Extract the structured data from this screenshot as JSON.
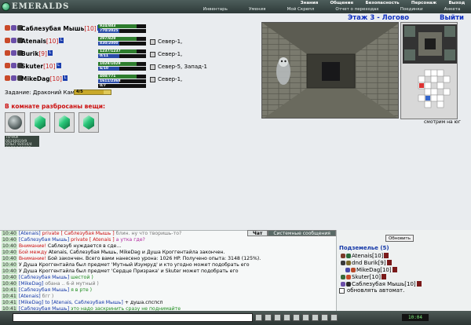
{
  "header": {
    "logo_text": "EMERALDS",
    "menu_top": [
      "Знания",
      "Общение",
      "Безопасность",
      "Персонаж",
      "Выход"
    ],
    "menu_bottom": [
      "Инвентарь",
      "Умения",
      "Мой Скрепл",
      "Отчет о переходах",
      "Поединки",
      "Анкета"
    ]
  },
  "players": [
    {
      "name": "Саблезубая Мышь",
      "level": "[10]",
      "badge": "L",
      "hp": "924/883",
      "mp": "770/2025",
      "loc": ""
    },
    {
      "name": "Atenais",
      "level": "[10]",
      "badge": "L",
      "hp": "297/829",
      "mp": "830/2000",
      "loc": "Север-1,"
    },
    {
      "name": "Burik",
      "level": "[9]",
      "badge": "L",
      "hp": "1237/1237",
      "mp": "0/11",
      "loc": "Север-1,"
    },
    {
      "name": "Skuter",
      "level": "[10]",
      "badge": "L",
      "hp": "1029/1029",
      "mp": "6/10",
      "loc": "Север-5, Запад-1"
    },
    {
      "name": "MikeDag",
      "level": "[10]",
      "badge": "L",
      "hp": "408/771",
      "mp": "1611/2368",
      "extra": "0/7",
      "loc": "Север-1,"
    }
  ],
  "task": {
    "label": "Задание: Драконий Камень",
    "progress_text": "4/5",
    "progress": 0.8
  },
  "items": {
    "title": "В комнате разбросаны вещи:",
    "list": [
      "stone",
      "emerald",
      "emerald",
      "emerald"
    ]
  },
  "stats_box": [
    "ТОЧКИ 00100019/9",
    "ОПЫТ 92016/4",
    "ГОЛОС 22917"
  ],
  "dungeon": {
    "floor": "Этаж 3 - Логово",
    "exit": "Выйти",
    "look": "смотрим на юг"
  },
  "chat": {
    "tabs": [
      "Чат",
      "Системные сообщения"
    ],
    "lines": [
      {
        "time": "10:40",
        "parts": [
          [
            "[Atenais] ",
            "blue"
          ],
          [
            "private [ Саблезубая Мышь ]",
            "red"
          ],
          [
            " блин. ну что творишь-то?",
            "grey"
          ]
        ]
      },
      {
        "time": "10:40",
        "parts": [
          [
            "[Саблезубая Мышь] ",
            "blue"
          ],
          [
            "private [ Atenais ]",
            "red"
          ],
          [
            " а утка где?",
            "mag"
          ]
        ]
      },
      {
        "time": "10:40",
        "parts": [
          [
            "Внимание!",
            "red"
          ],
          [
            " Саблезуб нуждается в сде...",
            "sys"
          ]
        ]
      },
      {
        "time": "10:40",
        "parts": [
          [
            "Бой между ",
            "red"
          ],
          [
            "Atenais, Саблезубая Мышь, MikeDag",
            "sys"
          ],
          [
            " и Душа Кроггентайла закончен.",
            "sys"
          ]
        ]
      },
      {
        "time": "10:40",
        "parts": [
          [
            "Внимание!",
            "red"
          ],
          [
            " Бой закончен. Всего вами нанесено урона: 1026 HP. Получено опыта: 3148 (125%).",
            "sys"
          ]
        ]
      },
      {
        "time": "10:40",
        "parts": [
          [
            "У Душа Кроггентайла был предмет 'Мутный Изумруд' и кто угодно может подобрать его",
            "sys"
          ]
        ]
      },
      {
        "time": "10:40",
        "parts": [
          [
            "У Душа Кроггентайла был предмет 'Сердце Призрака' и Skuter может подобрать его",
            "sys"
          ]
        ]
      },
      {
        "time": "10:40",
        "parts": [
          [
            "[Саблезубая Мышь] ",
            "blue"
          ],
          [
            "шестой )",
            "green"
          ]
        ]
      },
      {
        "time": "10:40",
        "parts": [
          [
            "[MikeDag] ",
            "blue"
          ],
          [
            "обана .. 6-й мутный )",
            "grey"
          ]
        ]
      },
      {
        "time": "10:41",
        "parts": [
          [
            "[Саблезубая Мышь] ",
            "blue"
          ],
          [
            "я в рте )",
            "green"
          ]
        ]
      },
      {
        "time": "10:41",
        "parts": [
          [
            "[Atenais] ",
            "blue"
          ],
          [
            "бгг )",
            "grey"
          ]
        ]
      },
      {
        "time": "10:41",
        "parts": [
          [
            "[MikeDag] to [Atenais, Саблезубая Мышь] ",
            "blue"
          ],
          [
            "+ душа.спспсп",
            "sys"
          ]
        ]
      },
      {
        "time": "10:41",
        "parts": [
          [
            "[Саблезубая Мышь] ",
            "blue"
          ],
          [
            "это надо заскринить сразу не поднимайте",
            "green"
          ]
        ]
      }
    ]
  },
  "online": {
    "refresh_label": "Обновить",
    "title": "Подземелье (5)",
    "users": [
      "Atenais[10]",
      "dnd Burik[9]",
      "MikeDag[10]",
      "Skuter[10]",
      "Саблезубая Мышь[10]"
    ],
    "auto_label": "обновлять автомат."
  },
  "clock": "10:04",
  "colors": {
    "accent": "#1438a8",
    "alert": "#cc1111",
    "header": "#3a4746"
  }
}
